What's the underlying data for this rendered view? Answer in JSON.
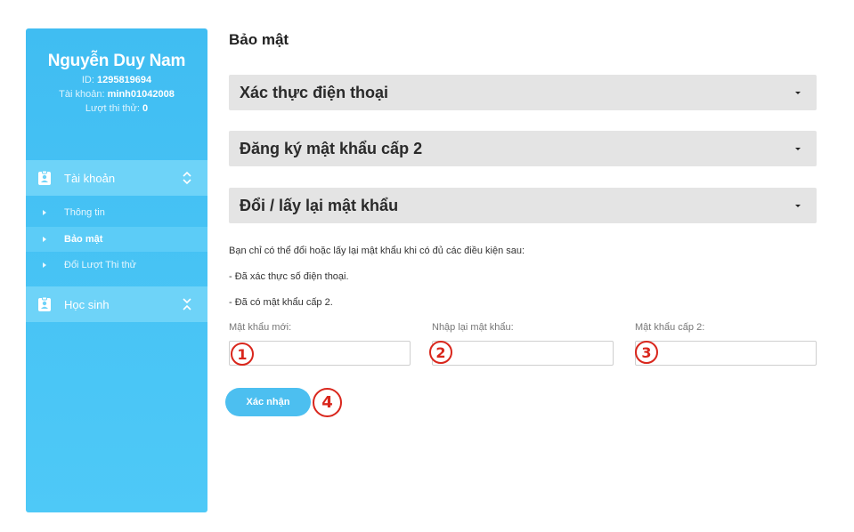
{
  "profile": {
    "name": "Nguyễn Duy Nam",
    "id_label": "ID:",
    "id_value": "1295819694",
    "account_label": "Tài khoản:",
    "account_value": "minh01042008",
    "trial_label": "Lượt thi thử:",
    "trial_value": "0"
  },
  "sidebar": {
    "groups": [
      {
        "label": "Tài khoản",
        "icon": "badge-icon",
        "state": "expanded"
      },
      {
        "label": "Học sinh",
        "icon": "badge-icon",
        "state": "collapsed"
      }
    ],
    "items": [
      {
        "label": "Thông tin",
        "active": false
      },
      {
        "label": "Bảo mật",
        "active": true
      },
      {
        "label": "Đổi Lượt Thi thử",
        "active": false
      }
    ]
  },
  "main": {
    "title": "Bảo mật",
    "accordions": [
      {
        "label": "Xác thực điện thoại"
      },
      {
        "label": "Đăng ký mật khẩu cấp 2"
      },
      {
        "label": "Đổi / lấy lại mật khẩu"
      }
    ],
    "notes": [
      "Bạn chỉ có thể đổi hoặc lấy lại mật khẩu khi có đủ các điều kiện sau:",
      "- Đã xác thực số điện thoại.",
      "- Đã có mật khẩu cấp 2."
    ],
    "fields": [
      {
        "label": "Mật khẩu mới:",
        "value": "",
        "marker": "1"
      },
      {
        "label": "Nhập lại mật khẩu:",
        "value": "",
        "marker": "2"
      },
      {
        "label": "Mật khẩu cấp 2:",
        "value": "",
        "marker": "3"
      }
    ],
    "submit_label": "Xác nhận",
    "submit_marker": "4"
  },
  "colors": {
    "sidebar": "#40bdf2",
    "accordion_bg": "#e4e4e4",
    "button": "#4cbff0",
    "marker": "#d9261c"
  }
}
